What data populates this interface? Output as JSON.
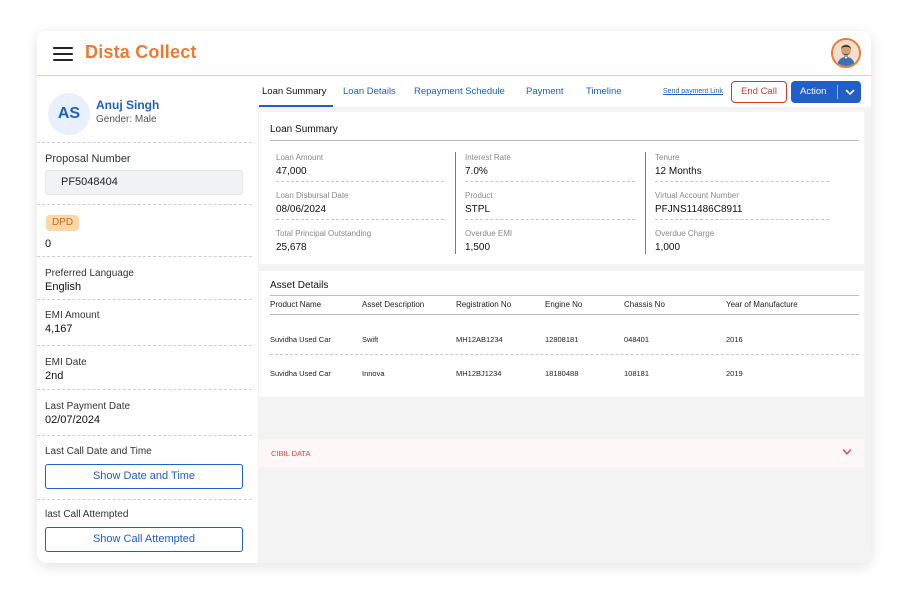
{
  "app": {
    "title": "Dista Collect"
  },
  "header": {
    "menu_icon": "hamburger-icon",
    "avatar_icon": "user-photo-icon"
  },
  "profile": {
    "initials": "AS",
    "name": "Anuj Singh",
    "gender": "Gender: Male"
  },
  "sidebar": {
    "proposal_label": "Proposal Number",
    "proposal_value": "PF5048404",
    "dpd_label": "DPD",
    "dpd_value": "0",
    "language_label": "Preferred Language",
    "language_value": "English",
    "emi_amount_label": "EMI Amount",
    "emi_amount_value": "4,167",
    "emi_date_label": "EMI Date",
    "emi_date_value": "2nd",
    "last_payment_label": "Last Payment Date",
    "last_payment_value": "02/07/2024",
    "last_call_label": "Last Call Date and Time",
    "last_call_button": "Show Date and Time",
    "last_attempt_label": "last Call Attempted",
    "last_attempt_button": "Show Call Attempted"
  },
  "tabs": [
    "Loan Summary",
    "Loan Details",
    "Repayment Schedule",
    "Payment",
    "Timeline"
  ],
  "toolbar": {
    "send_link": "Send payment Link",
    "end_call": "End Call",
    "action": "Action",
    "accent": "#1f5fc7",
    "danger": "#d93535"
  },
  "loan_summary": {
    "title": "Loan Summary",
    "fields": [
      {
        "label": "Loan Amount",
        "value": "47,000"
      },
      {
        "label": "Interest Rate",
        "value": "7.0%"
      },
      {
        "label": "Tenure",
        "value": "12 Months"
      },
      {
        "label": "Loan Disbursal Date",
        "value": "08/06/2024"
      },
      {
        "label": "Product",
        "value": "STPL"
      },
      {
        "label": "Virtual Account Number",
        "value": "PFJNS11486C8911"
      },
      {
        "label": "Total Principal Outstanding",
        "value": "25,678"
      },
      {
        "label": "Overdue EMI",
        "value": "1,500"
      },
      {
        "label": "Overdue Charge",
        "value": "1,000"
      }
    ]
  },
  "asset_details": {
    "title": "Asset Details",
    "columns": [
      "Product Name",
      "Asset Description",
      "Registration No",
      "Engine No",
      "Chassis No",
      "Year of Manufacture"
    ],
    "rows": [
      [
        "Suvidha Used Car",
        "Swift",
        "MH12AB1234",
        "12808181",
        "048401",
        "2016"
      ],
      [
        "Suvidha Used Car",
        "Innova",
        "MH12BJ1234",
        "18180488",
        "108181",
        "2019"
      ]
    ]
  },
  "cibil": {
    "label": "CIBIL DATA",
    "chevron_icon": "chevron-down-icon"
  }
}
